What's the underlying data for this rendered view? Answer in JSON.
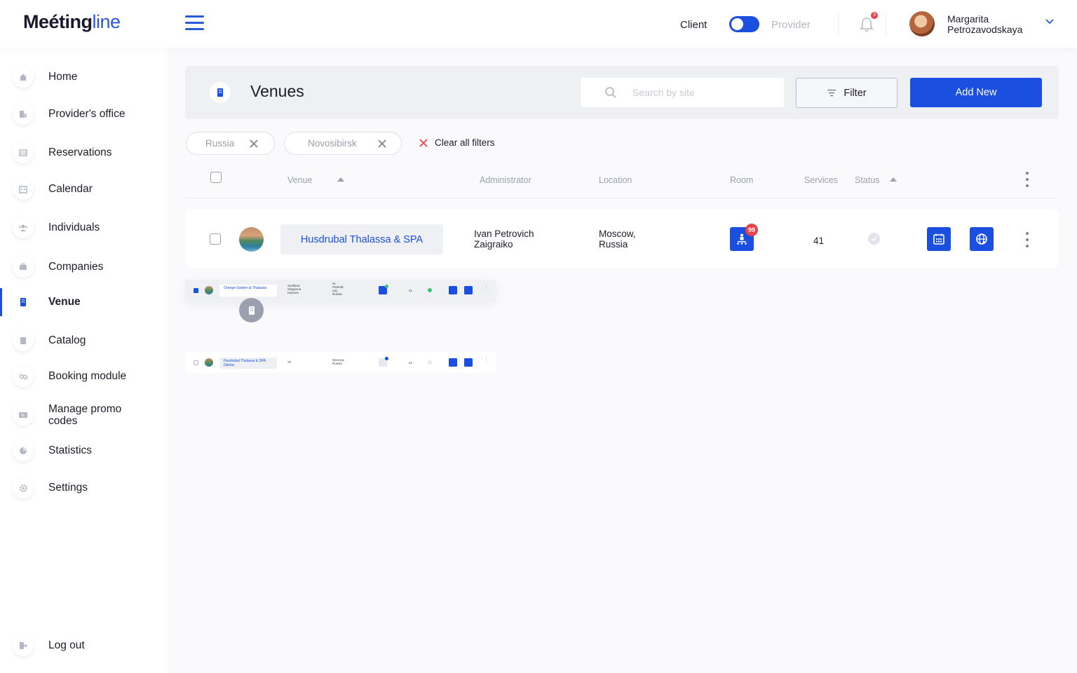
{
  "header": {
    "logo_bold": "Meéting",
    "logo_light": "line",
    "role_client": "Client",
    "role_provider": "Provider",
    "notifications_count": "3",
    "user_name": "Margarita Petrozavodskaya"
  },
  "sidebar": {
    "items": [
      {
        "label": "Home",
        "icon": "home-icon"
      },
      {
        "label": "Provider's office",
        "icon": "office-icon"
      },
      {
        "label": "Reservations",
        "icon": "reservations-icon"
      },
      {
        "label": "Calendar",
        "icon": "calendar-icon"
      },
      {
        "label": "Individuals",
        "icon": "individuals-icon"
      },
      {
        "label": "Companies",
        "icon": "companies-icon"
      },
      {
        "label": "Venue",
        "icon": "venue-icon",
        "active": true
      },
      {
        "label": "Catalog",
        "icon": "catalog-icon"
      },
      {
        "label": "Booking module",
        "icon": "link-icon"
      },
      {
        "label": "Manage promo codes",
        "icon": "promo-icon"
      },
      {
        "label": "Statistics",
        "icon": "pie-chart-icon"
      },
      {
        "label": "Settings",
        "icon": "gear-icon"
      }
    ],
    "logout": "Log out"
  },
  "page": {
    "title": "Venues",
    "search_placeholder": "Search by site",
    "filter_label": "Filter",
    "add_label": "Add New",
    "chips": [
      "Russia",
      "Novosibirsk"
    ],
    "clear_all": "Clear all filters"
  },
  "table": {
    "columns": {
      "venue": "Venue",
      "administrator": "Administrator",
      "location": "Location",
      "room": "Room",
      "services": "Services",
      "status": "Status"
    },
    "row": {
      "venue": "Husdrubal Thalassa & SPA",
      "admin_line1": "Ivan Petrovich",
      "admin_line2": "Zaigraiko",
      "loc_line1": "Moscow,",
      "loc_line2": "Russia",
      "room_badge": "99",
      "services": "41"
    }
  },
  "drag_preview": {
    "venue": "Orange Garden & Thalassa",
    "admin": "Svetlana Olegovna Ivanova",
    "location": "St. Peterab urg, Russia",
    "services": "41"
  },
  "ghost_row": {
    "venue": "Husdrubal Thalassa & SPA Djerba",
    "admin": "70",
    "location": "Moscow, Russia",
    "services": "41"
  },
  "colors": {
    "accent": "#1a4fe0",
    "badge": "#e8434a",
    "status_active": "#3cc46a"
  }
}
